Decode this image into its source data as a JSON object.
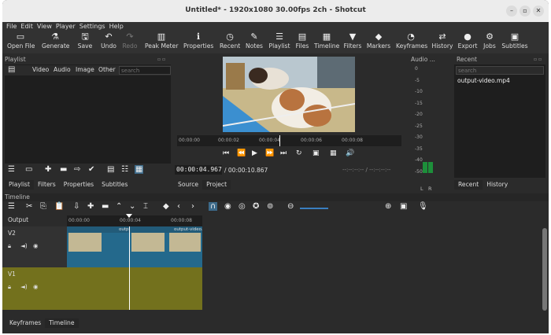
{
  "window": {
    "title": "Untitled* - 1920x1080 30.00fps 2ch - Shotcut",
    "controls": [
      "–",
      "▫",
      "✕"
    ]
  },
  "menu": [
    "File",
    "Edit",
    "View",
    "Player",
    "Settings",
    "Help"
  ],
  "toolbar": [
    {
      "label": "Open File",
      "icon": "▭"
    },
    {
      "label": "Generate",
      "icon": "⚗"
    },
    {
      "label": "Save",
      "icon": "🖫"
    },
    {
      "label": "Undo",
      "icon": "↶"
    },
    {
      "label": "Redo",
      "icon": "↷"
    },
    {
      "label": "Peak Meter",
      "icon": "▥"
    },
    {
      "label": "Properties",
      "icon": "ℹ"
    },
    {
      "label": "Recent",
      "icon": "◷"
    },
    {
      "label": "Notes",
      "icon": "✎"
    },
    {
      "label": "Playlist",
      "icon": "☰"
    },
    {
      "label": "Files",
      "icon": "▤"
    },
    {
      "label": "Timeline",
      "icon": "▦"
    },
    {
      "label": "Filters",
      "icon": "▼"
    },
    {
      "label": "Markers",
      "icon": "◆"
    },
    {
      "label": "Keyframes",
      "icon": "◔"
    },
    {
      "label": "History",
      "icon": "⇄"
    },
    {
      "label": "Export",
      "icon": "●"
    },
    {
      "label": "Jobs",
      "icon": "⚙"
    },
    {
      "label": "Subtitles",
      "icon": "▣"
    }
  ],
  "playlist": {
    "title": "Playlist",
    "filters": [
      "Video",
      "Audio",
      "Image",
      "Other"
    ],
    "search_placeholder": "search",
    "tabs": [
      "Playlist",
      "Filters",
      "Properties",
      "Subtitles"
    ]
  },
  "player": {
    "ruler": [
      "00:00:00",
      "00:00:02",
      "00:00:04",
      "00:00:06",
      "00:00:08"
    ],
    "position": "00:00:04.967",
    "duration": "/ 00:00:10.867",
    "in_out": "--:--:--:-- / --:--:--:--",
    "tabs": [
      "Source",
      "Project"
    ]
  },
  "audio": {
    "title": "Audio ...",
    "scale": [
      "0",
      "-5",
      "-10",
      "-15",
      "-20",
      "-25",
      "-30",
      "-35",
      "-40",
      "-50"
    ],
    "channels": [
      "L",
      "R"
    ]
  },
  "recent": {
    "title": "Recent",
    "search_placeholder": "search",
    "items": [
      "output-video.mp4"
    ],
    "tabs": [
      "Recent",
      "History"
    ]
  },
  "timeline": {
    "title": "Timeline",
    "output_label": "Output",
    "ruler": [
      "00:00:00",
      "00:00:04",
      "00:00:08"
    ],
    "tracks": [
      {
        "name": "V2",
        "clip_labels": [
          "output-video",
          "output-video.mp4"
        ]
      },
      {
        "name": "V1"
      }
    ],
    "bottom_tabs": [
      "Keyframes",
      "Timeline"
    ]
  }
}
